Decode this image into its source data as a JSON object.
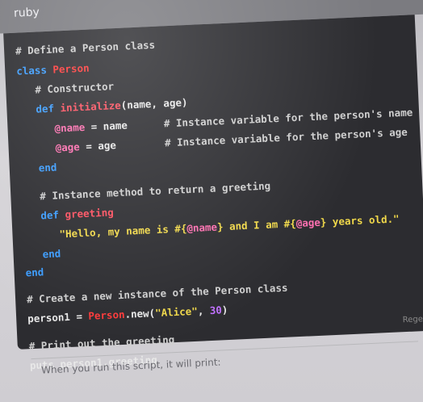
{
  "header": {
    "language": "ruby"
  },
  "code_lines": [
    "# Define a Person class",
    "class Person",
    "# Constructor",
    "def initialize(name, age)",
    "@name = name      # Instance variable for the person's name",
    "@age = age        # Instance variable for the person's age",
    "end",
    "# Instance method to return a greeting",
    "def greeting",
    "\"Hello, my name is #{@name} and I am #{@age} years old.\"",
    "end",
    "end",
    "# Create a new instance of the Person class",
    "person1 = Person.new(\"Alice\", 30)",
    "# Print out the greeting",
    "puts person1.greeting"
  ],
  "copy_label": "Rege",
  "footer_text": "When you run this script, it will print:",
  "colors": {
    "keyword": "#3a9cff",
    "class_name": "#ff3a3a",
    "method": "#ff5060",
    "string": "#f0d84a",
    "ivar": "#ff6fb0",
    "background": "#2c2c30"
  }
}
